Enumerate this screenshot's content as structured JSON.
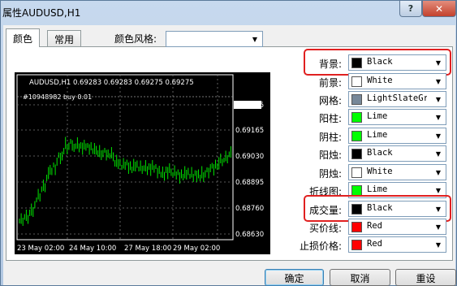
{
  "window": {
    "title": "属性AUDUSD,H1",
    "help_label": "?",
    "close_label": "✕"
  },
  "tabs": [
    {
      "label": "颜色"
    },
    {
      "label": "常用"
    }
  ],
  "scheme": {
    "label": "颜色风格:",
    "value": ""
  },
  "chart_preview": {
    "header": "AUDUSD,H1  0.69283 0.69283 0.69275 0.69275",
    "order_label": "#10948982 buy 0.01",
    "price_labels": [
      "0.69275",
      "0.69165",
      "0.69030",
      "0.68895",
      "0.68760",
      "0.68630"
    ],
    "time_labels": [
      "23 May 02:00",
      "24 May 10:00",
      "27 May 18:00",
      "29 May 02:00"
    ],
    "colors": {
      "background": "#000000",
      "foreground": "#ffffff",
      "grid": "#777777",
      "candle": "#00e600",
      "current": "#ffffff"
    }
  },
  "properties": [
    {
      "label": "背景:",
      "color": "Black",
      "hex": "#000000",
      "highlighted": true
    },
    {
      "label": "前景:",
      "color": "White",
      "hex": "#ffffff",
      "highlighted": false
    },
    {
      "label": "网格:",
      "color": "LightSlateGr",
      "hex": "#778899",
      "highlighted": false
    },
    {
      "label": "阳柱:",
      "color": "Lime",
      "hex": "#00ff00",
      "highlighted": false
    },
    {
      "label": "阴柱:",
      "color": "Lime",
      "hex": "#00ff00",
      "highlighted": false
    },
    {
      "label": "阳烛:",
      "color": "Black",
      "hex": "#000000",
      "highlighted": false
    },
    {
      "label": "阴烛:",
      "color": "White",
      "hex": "#ffffff",
      "highlighted": false
    },
    {
      "label": "折线图:",
      "color": "Lime",
      "hex": "#00ff00",
      "highlighted": false
    },
    {
      "label": "成交量:",
      "color": "Black",
      "hex": "#000000",
      "highlighted": true
    },
    {
      "label": "买价线:",
      "color": "Red",
      "hex": "#ff0000",
      "highlighted": false
    },
    {
      "label": "止损价格:",
      "color": "Red",
      "hex": "#ff0000",
      "highlighted": false
    }
  ],
  "buttons": {
    "ok": "确定",
    "cancel": "取消",
    "reset": "重设"
  }
}
